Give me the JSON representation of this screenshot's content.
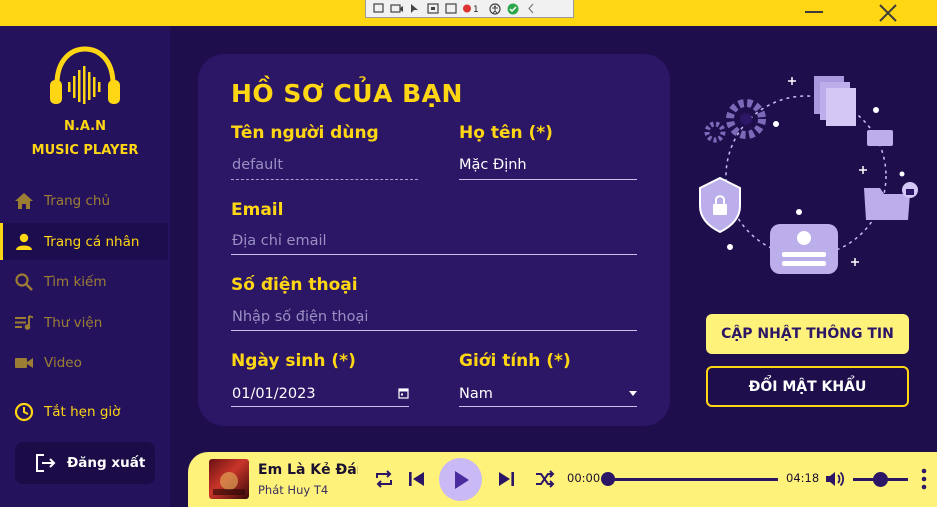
{
  "window": {
    "minimize_icon": "minimize-icon",
    "close_icon": "close-icon"
  },
  "sidebar": {
    "brand_line1": "N.A.N",
    "brand_line2": "MUSIC PLAYER",
    "items": [
      {
        "label": "Trang chủ",
        "icon": "home-icon",
        "active": false
      },
      {
        "label": "Trang cá nhân",
        "icon": "user-icon",
        "active": true
      },
      {
        "label": "Tìm kiếm",
        "icon": "search-icon",
        "active": false
      },
      {
        "label": "Thư viện",
        "icon": "library-icon",
        "active": false
      },
      {
        "label": "Video",
        "icon": "video-icon",
        "active": false
      }
    ],
    "timer_label": "Tắt hẹn giờ",
    "logout_label": "Đăng xuất"
  },
  "profile": {
    "title": "HỒ SƠ CỦA BẠN",
    "username_label": "Tên người dùng",
    "username_value": "default",
    "fullname_label": "Họ tên (*)",
    "fullname_value": "Mặc Định",
    "email_label": "Email",
    "email_placeholder": "Địa chỉ email",
    "phone_label": "Số điện thoại",
    "phone_placeholder": "Nhập số điện thoại",
    "birthday_label": "Ngày sinh (*)",
    "birthday_value": "01/01/2023",
    "gender_label": "Giới tính (*)",
    "gender_value": "Nam"
  },
  "actions": {
    "update_label": "CẬP NHẬT THÔNG TIN",
    "password_label": "ĐỔI MẬT KHẨU"
  },
  "player": {
    "song_title": "Em Là Kẻ Đáng Thương",
    "artist": "Phát Huy T4",
    "current_time": "00:00",
    "total_time": "04:18",
    "progress": 0,
    "volume": 0.5
  },
  "colors": {
    "accent": "#ffd614",
    "background": "#1e0f4c",
    "card": "#2b1766",
    "player": "#fff27a"
  }
}
